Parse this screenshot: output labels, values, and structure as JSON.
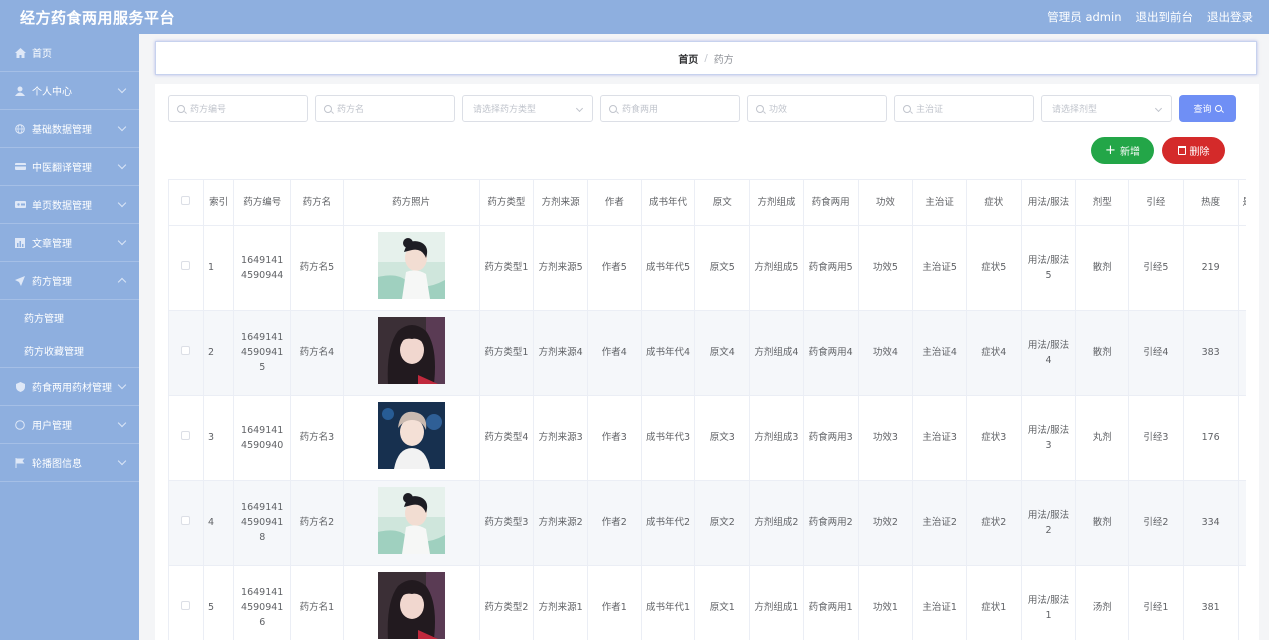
{
  "header": {
    "title": "经方药食两用服务平台",
    "admin_label": "管理员 admin",
    "to_frontend": "退出到前台",
    "logout": "退出登录"
  },
  "sidebar": {
    "items": [
      {
        "label": "首页",
        "icon": "home-icon"
      },
      {
        "label": "个人中心",
        "icon": "user-icon"
      },
      {
        "label": "基础数据管理",
        "icon": "globe-icon"
      },
      {
        "label": "中医翻译管理",
        "icon": "card-icon"
      },
      {
        "label": "单页数据管理",
        "icon": "ticket-icon"
      },
      {
        "label": "文章管理",
        "icon": "chart-icon"
      },
      {
        "label": "药方管理",
        "icon": "send-icon"
      },
      {
        "label": "药食两用药材管理",
        "icon": "shield-icon"
      },
      {
        "label": "用户管理",
        "icon": "circle-icon"
      },
      {
        "label": "轮播图信息",
        "icon": "flag-icon"
      }
    ],
    "submenu": [
      "药方管理",
      "药方收藏管理"
    ]
  },
  "breadcrumb": {
    "home": "首页",
    "separator": "/",
    "current": "药方"
  },
  "search": {
    "p1": "药方编号",
    "p2": "药方名",
    "p3": "请选择药方类型",
    "p4": "药食两用",
    "p5": "功效",
    "p6": "主治证",
    "p7": "请选择剂型",
    "query_label": "查询"
  },
  "actions": {
    "add_label": "新增",
    "delete_label": "删除"
  },
  "table": {
    "headers": [
      "索引",
      "药方编号",
      "药方名",
      "药方照片",
      "药方类型",
      "方剂来源",
      "作者",
      "成书年代",
      "原文",
      "方剂组成",
      "药食两用",
      "功效",
      "主治证",
      "症状",
      "用法/服法",
      "剂型",
      "引经",
      "热度",
      "是"
    ],
    "rows": [
      {
        "idx": "1",
        "code": "16491414590944",
        "name": "药方名5",
        "type": "药方类型1",
        "source": "方剂来源5",
        "author": "作者5",
        "era": "成书年代5",
        "text": "原文5",
        "comp": "方剂组成5",
        "dual": "药食两用5",
        "effect": "功效5",
        "indic": "主治证5",
        "symptom": "症状5",
        "usage": "用法/服法5",
        "form": "散剂",
        "guide": "引经5",
        "heat": "219",
        "photo": "photo-light"
      },
      {
        "idx": "2",
        "code": "164914145909415",
        "name": "药方名4",
        "type": "药方类型1",
        "source": "方剂来源4",
        "author": "作者4",
        "era": "成书年代4",
        "text": "原文4",
        "comp": "方剂组成4",
        "dual": "药食两用4",
        "effect": "功效4",
        "indic": "主治证4",
        "symptom": "症状4",
        "usage": "用法/服法4",
        "form": "散剂",
        "guide": "引经4",
        "heat": "383",
        "photo": "photo-dark"
      },
      {
        "idx": "3",
        "code": "16491414590940",
        "name": "药方名3",
        "type": "药方类型4",
        "source": "方剂来源3",
        "author": "作者3",
        "era": "成书年代3",
        "text": "原文3",
        "comp": "方剂组成3",
        "dual": "药食两用3",
        "effect": "功效3",
        "indic": "主治证3",
        "symptom": "症状3",
        "usage": "用法/服法3",
        "form": "丸剂",
        "guide": "引经3",
        "heat": "176",
        "photo": "photo-blue"
      },
      {
        "idx": "4",
        "code": "164914145909418",
        "name": "药方名2",
        "type": "药方类型3",
        "source": "方剂来源2",
        "author": "作者2",
        "era": "成书年代2",
        "text": "原文2",
        "comp": "方剂组成2",
        "dual": "药食两用2",
        "effect": "功效2",
        "indic": "主治证2",
        "symptom": "症状2",
        "usage": "用法/服法2",
        "form": "散剂",
        "guide": "引经2",
        "heat": "334",
        "photo": "photo-light"
      },
      {
        "idx": "5",
        "code": "164914145909416",
        "name": "药方名1",
        "type": "药方类型2",
        "source": "方剂来源1",
        "author": "作者1",
        "era": "成书年代1",
        "text": "原文1",
        "comp": "方剂组成1",
        "dual": "药食两用1",
        "effect": "功效1",
        "indic": "主治证1",
        "symptom": "症状1",
        "usage": "用法/服法1",
        "form": "汤剂",
        "guide": "引经1",
        "heat": "381",
        "photo": "photo-dark"
      }
    ]
  }
}
